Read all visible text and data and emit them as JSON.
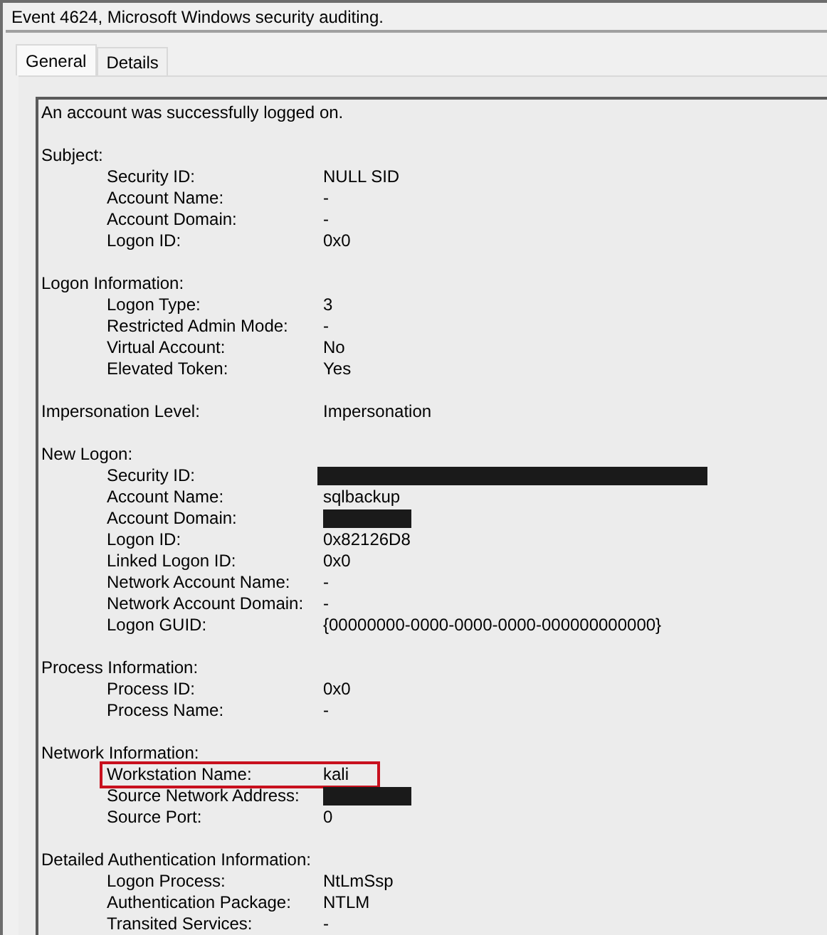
{
  "window": {
    "title": "Event 4624, Microsoft Windows security auditing."
  },
  "tabs": [
    {
      "label": "General",
      "selected": true
    },
    {
      "label": "Details",
      "selected": false
    }
  ],
  "summary": "An account was successfully logged on.",
  "sections": [
    {
      "title": "Subject:",
      "fields": [
        {
          "label": "Security ID:",
          "value": "NULL SID"
        },
        {
          "label": "Account Name:",
          "value": "-"
        },
        {
          "label": "Account Domain:",
          "value": "-"
        },
        {
          "label": "Logon ID:",
          "value": "0x0"
        }
      ]
    },
    {
      "title": "Logon Information:",
      "fields": [
        {
          "label": "Logon Type:",
          "value": "3"
        },
        {
          "label": "Restricted Admin Mode:",
          "value": "-"
        },
        {
          "label": "Virtual Account:",
          "value": "No"
        },
        {
          "label": "Elevated Token:",
          "value": "Yes"
        }
      ]
    },
    {
      "title": "Impersonation Level:",
      "value": "Impersonation"
    },
    {
      "title": "New Logon:",
      "fields": [
        {
          "label": "Security ID:",
          "kind": "redacted",
          "wide": true
        },
        {
          "label": "Account Name:",
          "value": "sqlbackup"
        },
        {
          "label": "Account Domain:",
          "kind": "redacted",
          "wide": false
        },
        {
          "label": "Logon ID:",
          "value": "0x82126D8"
        },
        {
          "label": "Linked Logon ID:",
          "value": "0x0"
        },
        {
          "label": "Network Account Name:",
          "value": "-"
        },
        {
          "label": "Network Account Domain:",
          "value": "-"
        },
        {
          "label": "Logon GUID:",
          "value": "{00000000-0000-0000-0000-000000000000}"
        }
      ]
    },
    {
      "title": "Process Information:",
      "fields": [
        {
          "label": "Process ID:",
          "value": "0x0"
        },
        {
          "label": "Process Name:",
          "value": "-"
        }
      ]
    },
    {
      "title": "Network Information:",
      "fields": [
        {
          "label": "Workstation Name:",
          "value": "kali",
          "highlighted": true
        },
        {
          "label": "Source Network Address:",
          "kind": "redacted",
          "wide": false
        },
        {
          "label": "Source Port:",
          "value": "0"
        }
      ]
    },
    {
      "title": "Detailed Authentication Information:",
      "fields": [
        {
          "label": "Logon Process:",
          "value": "NtLmSsp"
        },
        {
          "label": "Authentication Package:",
          "value": "NTLM"
        },
        {
          "label": "Transited Services:",
          "value": "-"
        }
      ]
    }
  ]
}
